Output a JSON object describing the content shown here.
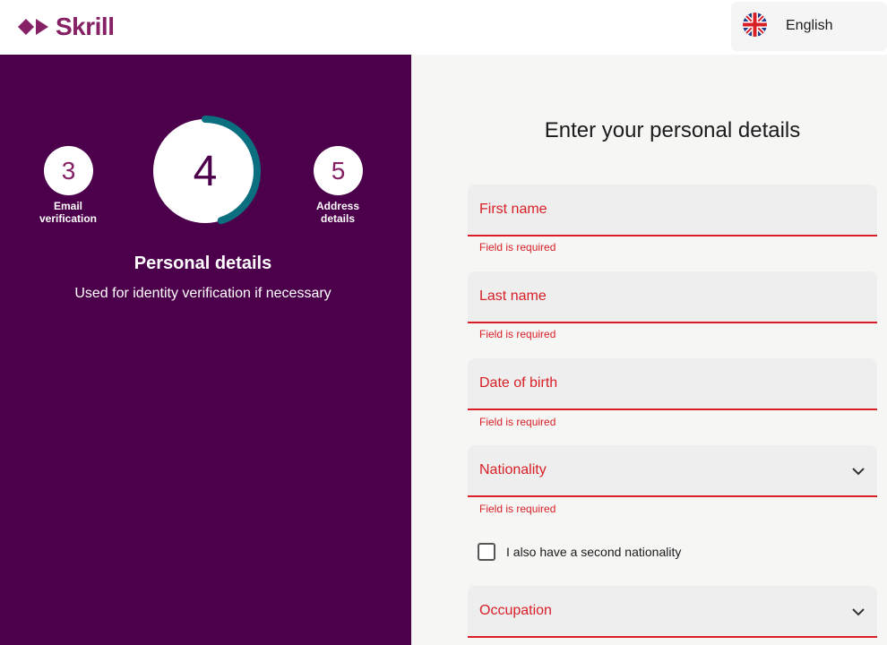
{
  "header": {
    "brand": "Skrill",
    "language": {
      "label": "English",
      "icon": "uk-flag-icon"
    }
  },
  "progress": {
    "steps": [
      {
        "number": "3",
        "label_line1": "Email",
        "label_line2": "verification"
      },
      {
        "number": "4",
        "current": true,
        "completion": 0.45
      },
      {
        "number": "5",
        "label_line1": "Address",
        "label_line2": "details"
      }
    ],
    "title": "Personal details",
    "subtitle": "Used for identity verification if necessary"
  },
  "form": {
    "title": "Enter your personal details",
    "fields": [
      {
        "label": "First name",
        "error": "Field is required",
        "type": "text"
      },
      {
        "label": "Last name",
        "error": "Field is required",
        "type": "text"
      },
      {
        "label": "Date of birth",
        "error": "Field is required",
        "type": "text"
      },
      {
        "label": "Nationality",
        "error": "Field is required",
        "type": "select",
        "icon": "chevron-down-icon"
      },
      {
        "label": "Occupation",
        "type": "select",
        "icon": "chevron-down-icon"
      }
    ],
    "second_nationality": {
      "label": "I also have a second nationality",
      "checked": false
    }
  },
  "colors": {
    "brand_purple": "#862165",
    "panel_purple": "#4c004b",
    "ring_teal": "#0b6f80",
    "error_red": "#d81f26"
  }
}
